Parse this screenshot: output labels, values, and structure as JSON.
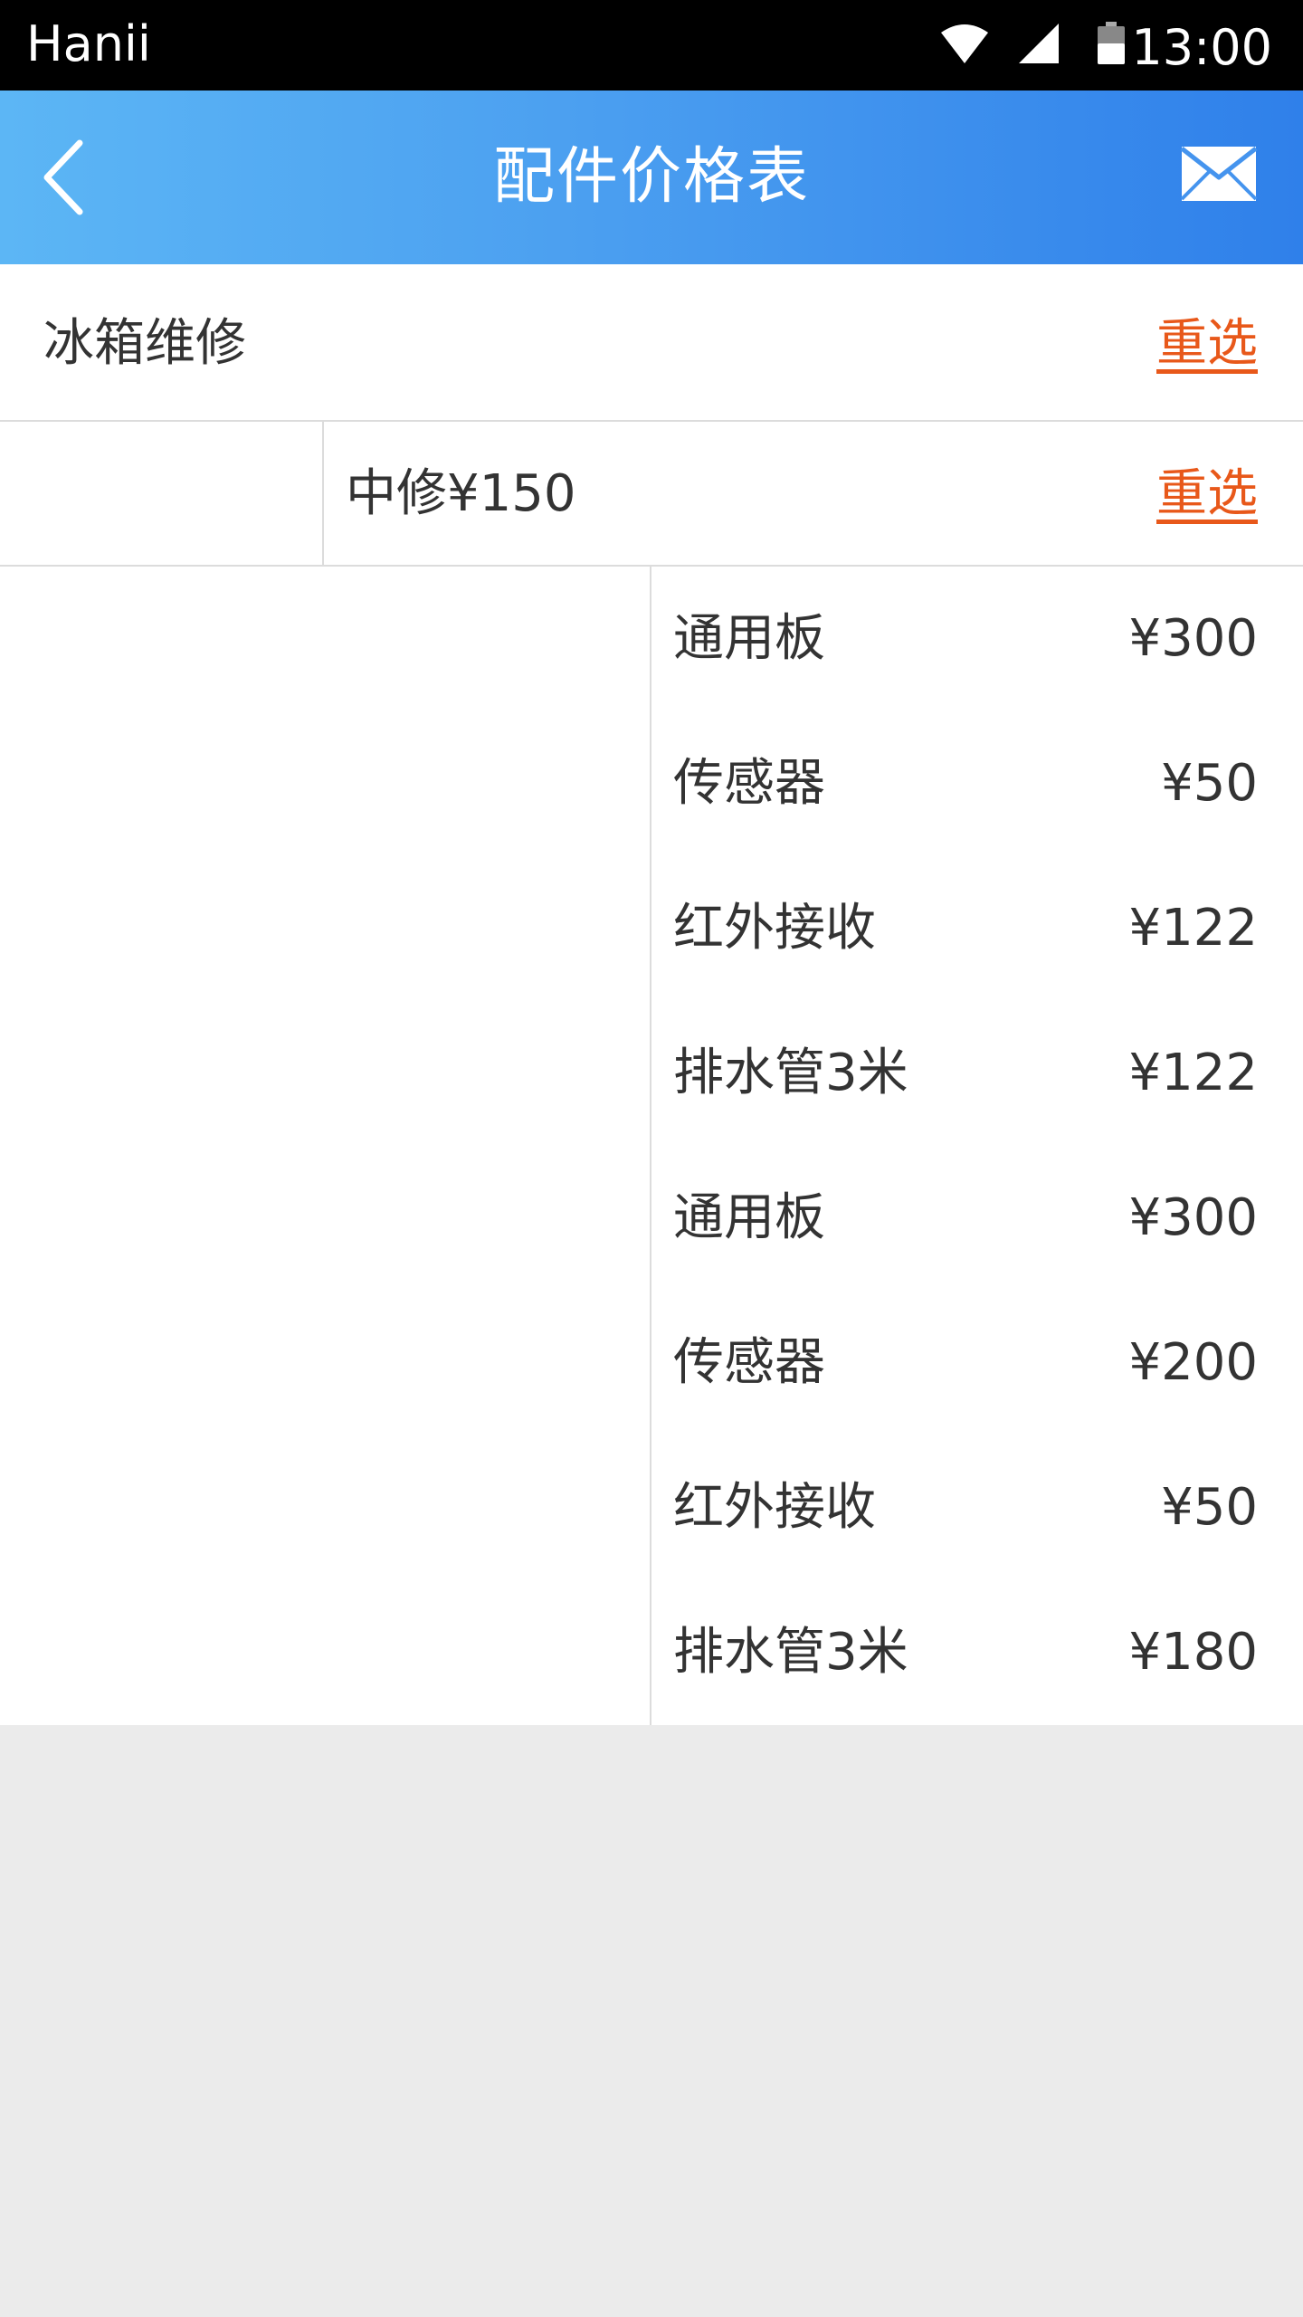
{
  "status_bar": {
    "carrier": "Hanii",
    "time": "13:00"
  },
  "nav": {
    "title": "配件价格表"
  },
  "selection": {
    "category": "冰箱维修",
    "category_reselect": "重选",
    "level": "中修¥150",
    "level_reselect": "重选"
  },
  "parts": [
    {
      "name": "通用板",
      "price": "¥300"
    },
    {
      "name": "传感器",
      "price": "¥50"
    },
    {
      "name": "红外接收",
      "price": "¥122"
    },
    {
      "name": "排水管3米",
      "price": "¥122"
    },
    {
      "name": "通用板",
      "price": "¥300"
    },
    {
      "name": "传感器",
      "price": "¥200"
    },
    {
      "name": "红外接收",
      "price": "¥50"
    },
    {
      "name": "排水管3米",
      "price": "¥180"
    }
  ],
  "colors": {
    "nav_gradient_start": "#5cb6f5",
    "nav_gradient_end": "#2f80ea",
    "reselect_link": "#e8581a",
    "page_background": "#ebebeb"
  },
  "icons": {
    "back": "chevron-left-icon",
    "mail": "mail-icon",
    "wifi": "wifi-icon",
    "signal": "signal-icon",
    "battery": "battery-icon"
  }
}
